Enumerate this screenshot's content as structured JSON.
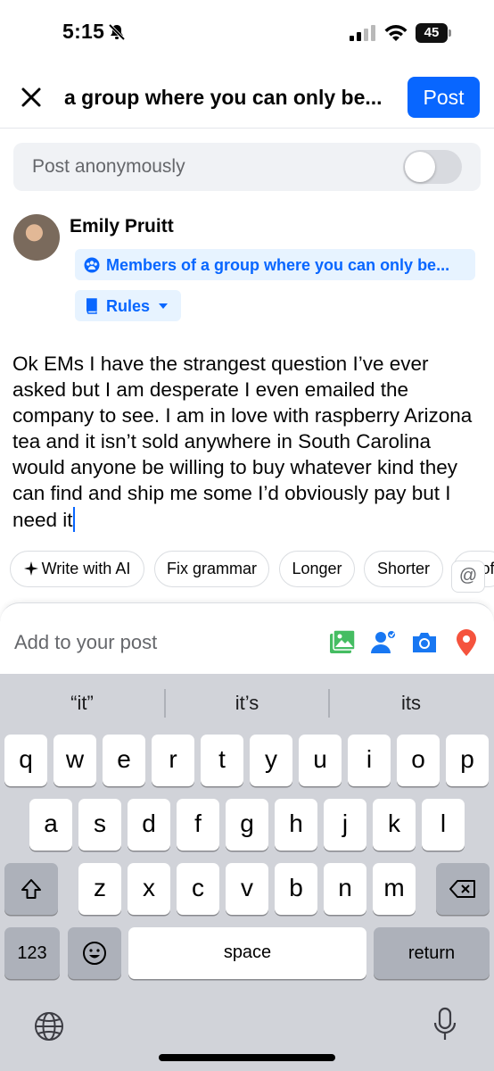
{
  "status_bar": {
    "time": "5:15",
    "battery": "45"
  },
  "header": {
    "title": "a group where you can only be...",
    "post_label": "Post"
  },
  "anonymous": {
    "label": "Post anonymously",
    "enabled": false
  },
  "author": {
    "name": "Emily Pruitt",
    "audience": "Members of a group where you can only be...",
    "rules_label": "Rules"
  },
  "post": {
    "text": "Ok EMs I have the strangest question I’ve ever asked but I am desperate I even emailed the company to see. I am in love with raspberry Arizona tea and it isn’t sold anywhere in South Carolina would anyone be willing to buy whatever kind they can find and ship me some I’d obviously pay but I need it"
  },
  "ai_chips": {
    "write_with_ai": "Write with AI",
    "fix_grammar": "Fix grammar",
    "longer": "Longer",
    "shorter": "Shorter",
    "more": "Prof",
    "mention": "@"
  },
  "add_to_post": {
    "label": "Add to your post",
    "icons": [
      "photo-icon",
      "tag-people-icon",
      "camera-icon",
      "location-icon"
    ]
  },
  "keyboard": {
    "predictions": [
      "“it”",
      "it’s",
      "its"
    ],
    "row1": [
      "q",
      "w",
      "e",
      "r",
      "t",
      "y",
      "u",
      "i",
      "o",
      "p"
    ],
    "row2": [
      "a",
      "s",
      "d",
      "f",
      "g",
      "h",
      "j",
      "k",
      "l"
    ],
    "row3": [
      "z",
      "x",
      "c",
      "v",
      "b",
      "n",
      "m"
    ],
    "numbers_label": "123",
    "space_label": "space",
    "return_label": "return"
  },
  "colors": {
    "accent": "#0866ff",
    "chip_bg": "#e7f3ff",
    "keyboard_bg": "#d1d3d9"
  }
}
